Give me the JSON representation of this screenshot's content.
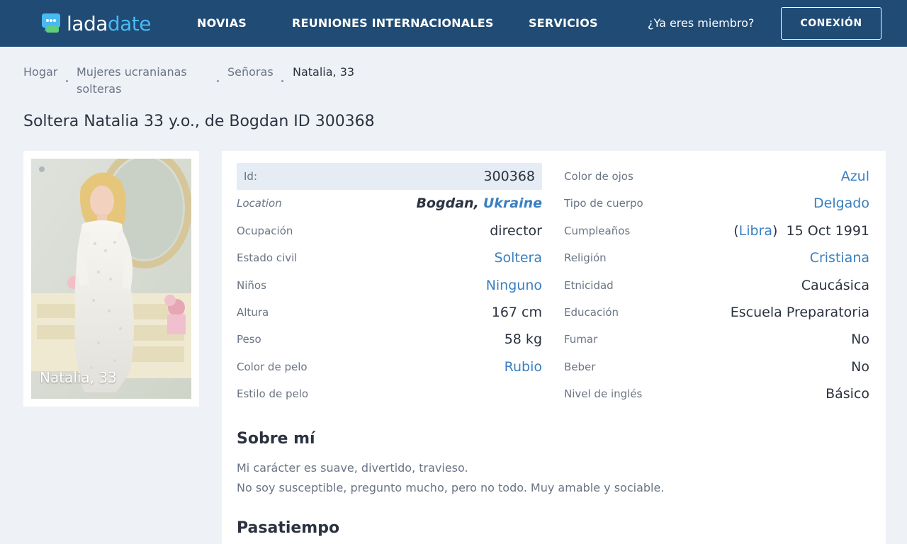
{
  "brand": {
    "part1": "lada",
    "part2": "date"
  },
  "nav": {
    "items": [
      "NOVIAS",
      "REUNIONES INTERNACIONALES",
      "SERVICIOS"
    ],
    "member_question": "¿Ya eres miembro?",
    "login_label": "CONEXIÓN"
  },
  "breadcrumb": {
    "home": "Hogar",
    "category_line1": "Mujeres ucranianas",
    "category_line2": "solteras",
    "ladies": "Señoras",
    "current": "Natalia, 33"
  },
  "page_title": "Soltera Natalia 33 y.o., de Bogdan ID 300368",
  "photo_caption": "Natalia, 33",
  "profile": {
    "left": [
      {
        "label": "Id:",
        "value": "300368"
      },
      {
        "label": "Location",
        "city": "Bogdan,",
        "country": "Ukraine"
      },
      {
        "label": "Ocupación",
        "value": "director"
      },
      {
        "label": "Estado civil",
        "value": "Soltera"
      },
      {
        "label": "Niños",
        "value": "Ninguno"
      },
      {
        "label": "Altura",
        "value": "167 cm"
      },
      {
        "label": "Peso",
        "value": "58 kg"
      },
      {
        "label": "Color de pelo",
        "value": "Rubio"
      },
      {
        "label": "Estilo de pelo",
        "value": ""
      }
    ],
    "right": [
      {
        "label": "Color de ojos",
        "value": "Azul"
      },
      {
        "label": "Tipo de cuerpo",
        "value": "Delgado"
      },
      {
        "label": "Cumpleaños",
        "zodiac_open": "(",
        "zodiac": "Libra",
        "zodiac_close": ")",
        "value": "15 Oct 1991"
      },
      {
        "label": "Religión",
        "value": "Cristiana"
      },
      {
        "label": "Etnicidad",
        "value": "Caucásica"
      },
      {
        "label": "Educación",
        "value": "Escuela Preparatoria"
      },
      {
        "label": "Fumar",
        "value": "No"
      },
      {
        "label": "Beber",
        "value": "No"
      },
      {
        "label": "Nivel de inglés",
        "value": "Básico"
      }
    ]
  },
  "about": {
    "title": "Sobre mí",
    "line1": "Mi carácter es suave, divertido, travieso.",
    "line2": "No soy susceptible, pregunto mucho, pero no todo. Muy amable y sociable."
  },
  "hobbies": {
    "title": "Pasatiempo"
  },
  "colors": {
    "header": "#1f4b75",
    "accent": "#49b9f2",
    "link": "#3a7fc1"
  }
}
